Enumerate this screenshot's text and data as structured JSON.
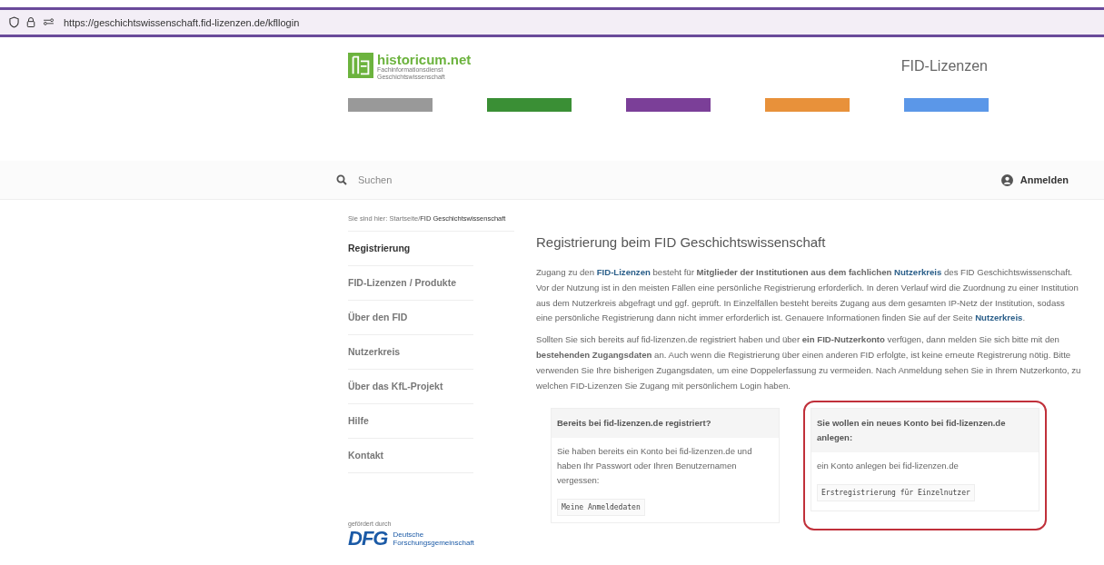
{
  "browser": {
    "url_host": "https://geschichtswissenschaft.fid-lizenzen.de",
    "url_path": "/kfllogin"
  },
  "header": {
    "logo_name": "historicum.net",
    "logo_sub": [
      "Fachinformationsdienst",
      "Geschichtswissenschaft"
    ],
    "site_title": "FID-Lizenzen",
    "color_bars": [
      {
        "color": "#999999"
      },
      {
        "color": "#3a8f35"
      },
      {
        "color": "#7b3f98"
      },
      {
        "color": "#e8913a"
      },
      {
        "color": "#5b97e8"
      }
    ]
  },
  "search": {
    "placeholder": "Suchen"
  },
  "login": {
    "label": "Anmelden"
  },
  "breadcrumb": {
    "prefix": "Sie sind hier:",
    "separator": "/",
    "items": [
      "Startseite",
      "FID Geschichtswissenschaft"
    ]
  },
  "nav": [
    {
      "label": "Registrierung",
      "selected": true
    },
    {
      "label": "FID-Lizenzen / Produkte",
      "selected": false
    },
    {
      "label": "Über den FID",
      "selected": false
    },
    {
      "label": "Nutzerkreis",
      "selected": false
    },
    {
      "label": "Über das KfL-Projekt",
      "selected": false
    },
    {
      "label": "Hilfe",
      "selected": false
    },
    {
      "label": "Kontakt",
      "selected": false
    }
  ],
  "funding": {
    "caption": "gefördert durch",
    "logo": "DFG",
    "name": [
      "Deutsche",
      "Forschungsgemeinschaft"
    ]
  },
  "title": "Registrierung beim FID Geschichtswissenschaft",
  "paragraphs": [
    [
      {
        "kind": "text",
        "text": "Zugang zu den "
      },
      {
        "kind": "link",
        "text": "FID-Lizenzen"
      },
      {
        "kind": "text",
        "text": " besteht für **Mitglieder der Institutionen aus dem fachlichen** "
      },
      {
        "kind": "link",
        "text": "Nutzerkreis"
      },
      {
        "kind": "text",
        "text": " des FID Geschichtswissenschaft. Vor der Nutzung ist in den meisten Fällen eine persönliche Registrierung erforderlich. In deren Verlauf wird die Zuordnung zu einer Institution aus dem Nutzerkreis abgefragt und ggf. geprüft. In Einzelfällen besteht bereits Zugang aus dem gesamten IP-Netz der Institution, sodass eine persönliche Registrierung dann nicht immer erforderlich ist. Genauere Informationen finden Sie auf der Seite "
      },
      {
        "kind": "link",
        "text": "Nutzerkreis"
      },
      {
        "kind": "text",
        "text": "."
      }
    ],
    [
      {
        "kind": "text",
        "text": "Sollten Sie sich bereits auf fid-lizenzen.de registriert haben und über **ein FID-Nutzerkonto** verfügen, dann melden Sie sich bitte mit den **bestehenden Zugangsdaten** an. Auch wenn die Registrierung über einen anderen FID erfolgte, ist keine erneute Registrerung nötig. Bitte verwenden Sie Ihre bisherigen Zugangsdaten, um eine Doppelerfassung zu vermeiden. Nach Anmeldung sehen Sie in Ihrem Nutzerkonto, zu welchen FID-Lizenzen Sie Zugang mit persönlichem Login haben."
      }
    ]
  ],
  "boxes": [
    {
      "heading": "Bereits bei fid-lizenzen.de registriert?",
      "text": "Sie haben bereits ein Konto bei fid-lizenzen.de und haben Ihr Passwort oder Ihren Benutzernamen vergessen:",
      "button": "Meine Anmeldedaten",
      "highlighted": false
    },
    {
      "heading": "Sie wollen ein neues Konto bei fid-lizenzen.de anlegen:",
      "text": "ein Konto anlegen bei fid-lizenzen.de",
      "button": "Erstregistrierung für Einzelnutzer",
      "highlighted": true
    }
  ]
}
